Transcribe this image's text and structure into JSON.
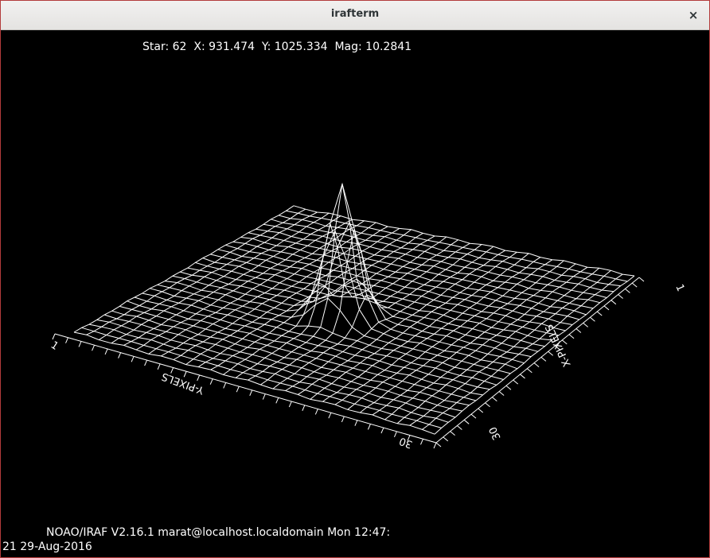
{
  "window": {
    "title": "irafterm",
    "close_glyph": "×"
  },
  "plot": {
    "star_info": "Star: 62  X: 931.474  Y: 1025.334  Mag: 10.2841",
    "footer_line1": "NOAO/IRAF V2.16.1 marat@localhost.localdomain Mon 12:47:",
    "footer_line2": "21 29-Aug-2016",
    "y_axis_label": "Y-PIXELS",
    "x_axis_label": "X-PIXELS",
    "y_axis_start": "1",
    "y_axis_end": "30",
    "x_axis_start": "1",
    "x_axis_end": "30",
    "grid_size": 30,
    "line_color": "#ffffff",
    "background_color": "#000000"
  }
}
